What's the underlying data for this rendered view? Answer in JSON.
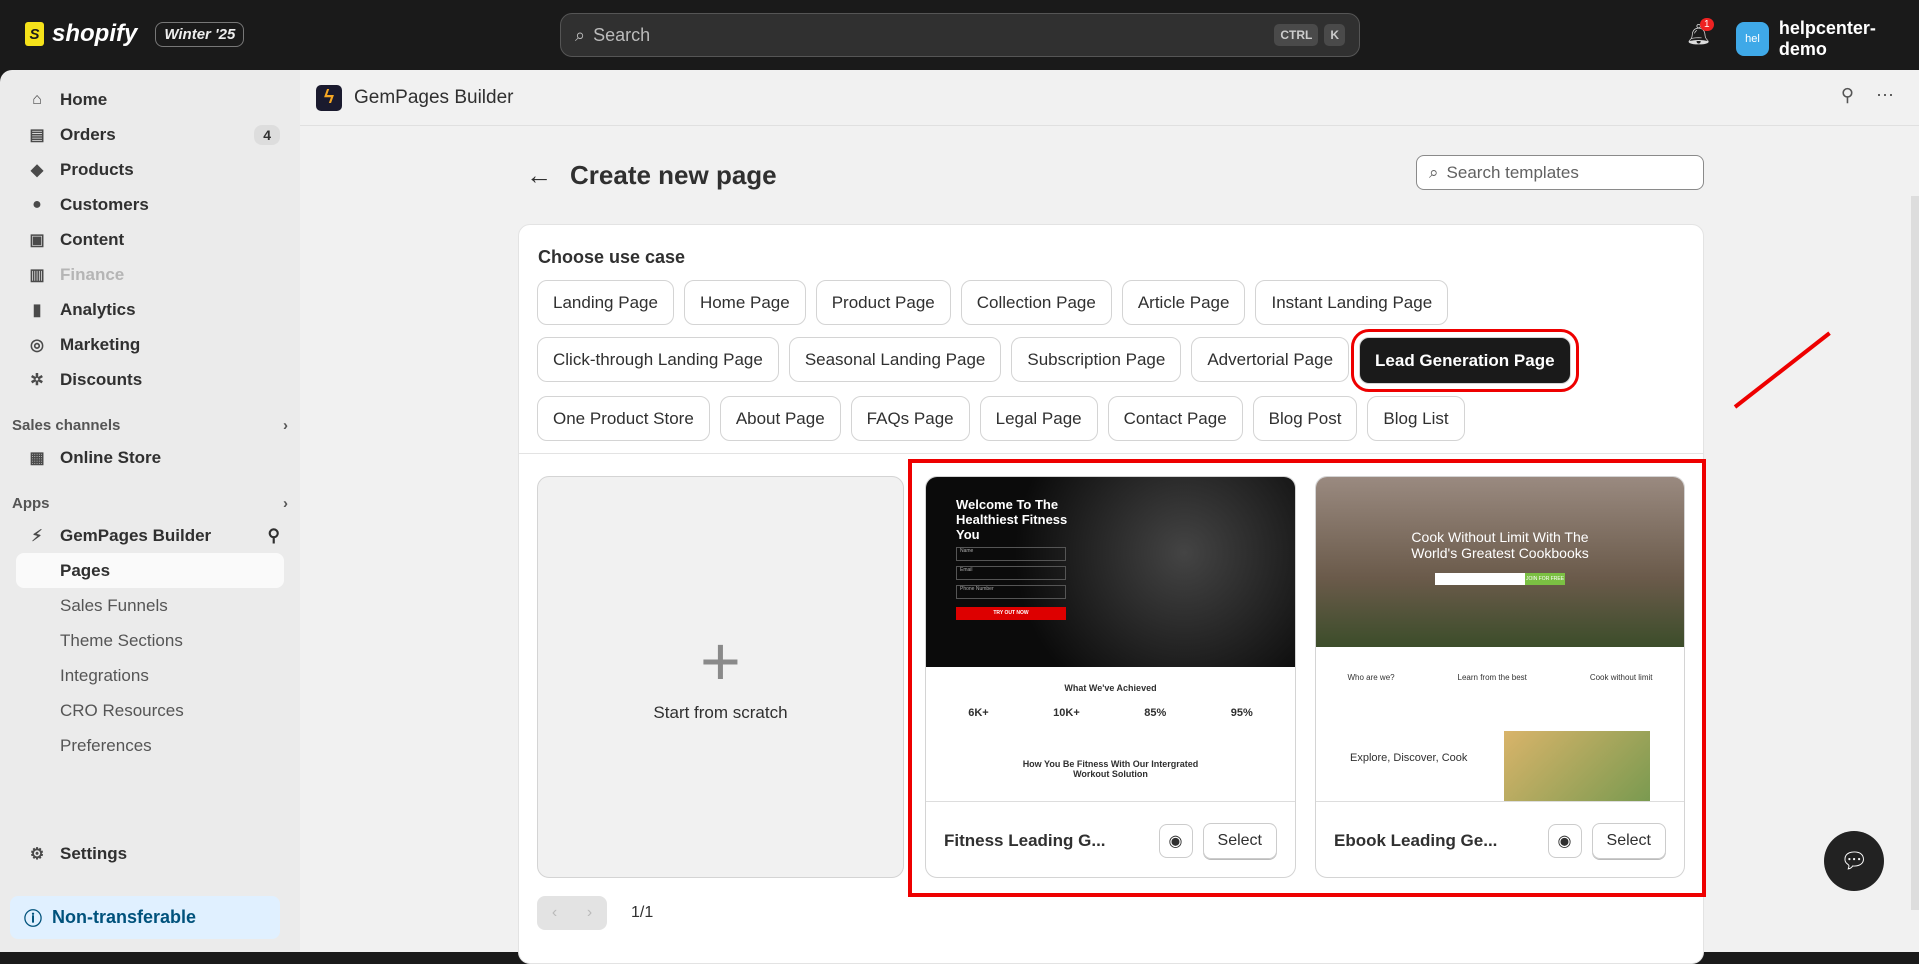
{
  "topbar": {
    "brand": "shopify",
    "version_badge": "Winter '25",
    "search_placeholder": "Search",
    "keys": [
      "CTRL",
      "K"
    ],
    "notifications": "1",
    "avatar_initials": "hel",
    "store": "helpcenter-demo"
  },
  "sidebar": {
    "items": [
      {
        "label": "Home",
        "icon": "⌂"
      },
      {
        "label": "Orders",
        "icon": "▤",
        "count": "4"
      },
      {
        "label": "Products",
        "icon": "◆"
      },
      {
        "label": "Customers",
        "icon": "●"
      },
      {
        "label": "Content",
        "icon": "▣"
      },
      {
        "label": "Finance",
        "icon": "▥"
      },
      {
        "label": "Analytics",
        "icon": "▮"
      },
      {
        "label": "Marketing",
        "icon": "◎"
      },
      {
        "label": "Discounts",
        "icon": "✲"
      }
    ],
    "sales_channels": "Sales channels",
    "online_store": "Online Store",
    "apps": "Apps",
    "gempages": "GemPages Builder",
    "subitems": [
      "Pages",
      "Sales Funnels",
      "Theme Sections",
      "Integrations",
      "CRO Resources",
      "Preferences"
    ],
    "settings": "Settings",
    "non_transferable": "Non-transferable"
  },
  "app": {
    "name": "GemPages Builder",
    "page_title": "Create new page",
    "search_placeholder": "Search templates"
  },
  "use_case": {
    "label": "Choose use case",
    "chips": [
      "Landing Page",
      "Home Page",
      "Product Page",
      "Collection Page",
      "Article Page",
      "Instant Landing Page",
      "Click-through Landing Page",
      "Seasonal Landing Page",
      "Subscription Page",
      "Advertorial Page",
      "Lead Generation Page",
      "One Product Store",
      "About Page",
      "FAQs Page",
      "Legal Page",
      "Contact Page",
      "Blog Post",
      "Blog List"
    ],
    "selected": "Lead Generation Page"
  },
  "scratch": "Start from scratch",
  "templates": [
    {
      "name": "Fitness Leading G...",
      "select": "Select",
      "hero": "Welcome To The Healthiest Fitness You",
      "fields": [
        "Name",
        "Email",
        "Phone Number"
      ],
      "cta": "TRY OUT NOW",
      "achieved": "What We've Achieved",
      "stats": [
        "6K+",
        "10K+",
        "85%",
        "95%"
      ],
      "sub": "How You Be Fitness With Our Intergrated Workout Solution"
    },
    {
      "name": "Ebook Leading Ge...",
      "select": "Select",
      "hero": "Cook Without Limit With The World's Greatest Cookbooks",
      "cta": "JOIN FOR FREE",
      "cols": [
        "Who are we?",
        "Learn from the best",
        "Cook without limit"
      ],
      "explore": "Explore, Discover, Cook"
    }
  ],
  "pagination": "1/1"
}
